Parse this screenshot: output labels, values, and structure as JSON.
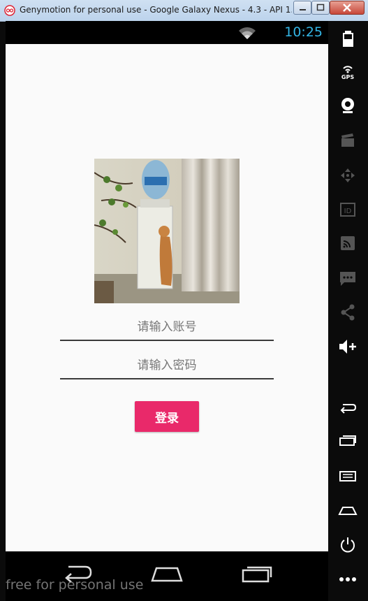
{
  "window": {
    "title": "Genymotion for personal use - Google Galaxy Nexus - 4.3 - API 1..."
  },
  "statusbar": {
    "time": "10:25"
  },
  "login": {
    "account_placeholder": "请输入账号",
    "password_placeholder": "请输入密码",
    "login_label": "登录"
  },
  "sidebar": {
    "gps_label": "GPS"
  },
  "watermark": "free for personal use",
  "colors": {
    "accent": "#e9296a",
    "clock": "#33b5e5"
  }
}
